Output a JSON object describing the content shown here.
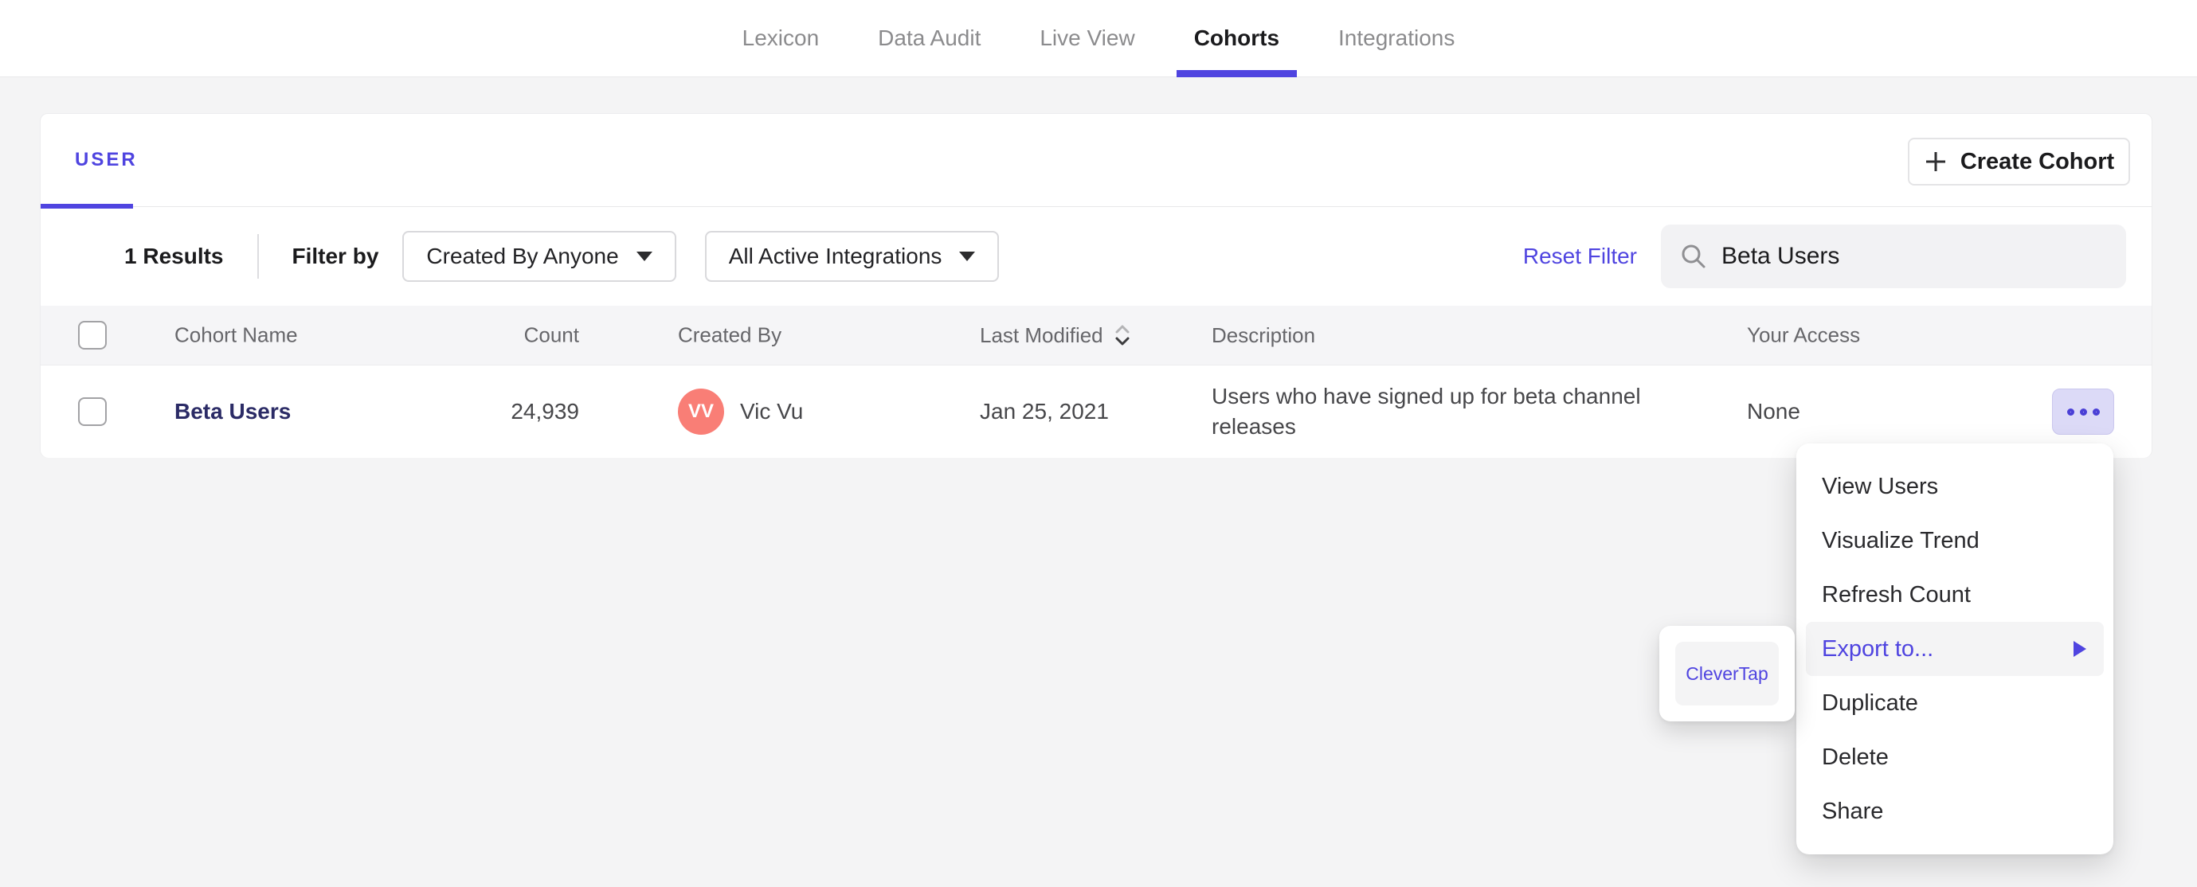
{
  "colors": {
    "accent": "#4f44e0",
    "page_background": "#f4f4f5",
    "avatar_background": "#f97e76",
    "actions_button_background": "#dcdaf7",
    "menu_highlight_background": "#f4f4f5",
    "cohort_link": "#2b2b66"
  },
  "nav": {
    "tabs": [
      {
        "label": "Lexicon"
      },
      {
        "label": "Data Audit"
      },
      {
        "label": "Live View"
      },
      {
        "label": "Cohorts",
        "active": true
      },
      {
        "label": "Integrations"
      }
    ]
  },
  "panel": {
    "active_tab": "USER",
    "create_button_label": "Create Cohort",
    "filter_bar": {
      "results_count": "1 Results",
      "filter_by_label": "Filter by",
      "created_by_dropdown": "Created By Anyone",
      "integrations_dropdown": "All Active Integrations",
      "reset_filter_label": "Reset Filter",
      "search_value": "Beta Users"
    },
    "table": {
      "headers": {
        "name": "Cohort Name",
        "count": "Count",
        "created_by": "Created By",
        "last_modified": "Last Modified",
        "description": "Description",
        "access": "Your Access"
      },
      "rows": [
        {
          "name": "Beta Users",
          "count": "24,939",
          "creator_initials": "VV",
          "creator_name": "Vic Vu",
          "last_modified": "Jan 25, 2021",
          "description": "Users who have signed up for beta channel releases",
          "access": "None"
        }
      ]
    }
  },
  "context_menu": {
    "items": [
      {
        "label": "View Users"
      },
      {
        "label": "Visualize Trend"
      },
      {
        "label": "Refresh Count"
      },
      {
        "label": "Export to...",
        "highlighted": true
      },
      {
        "label": "Duplicate"
      },
      {
        "label": "Delete"
      },
      {
        "label": "Share"
      }
    ],
    "submenu": {
      "items": [
        {
          "label": "CleverTap"
        }
      ]
    }
  }
}
